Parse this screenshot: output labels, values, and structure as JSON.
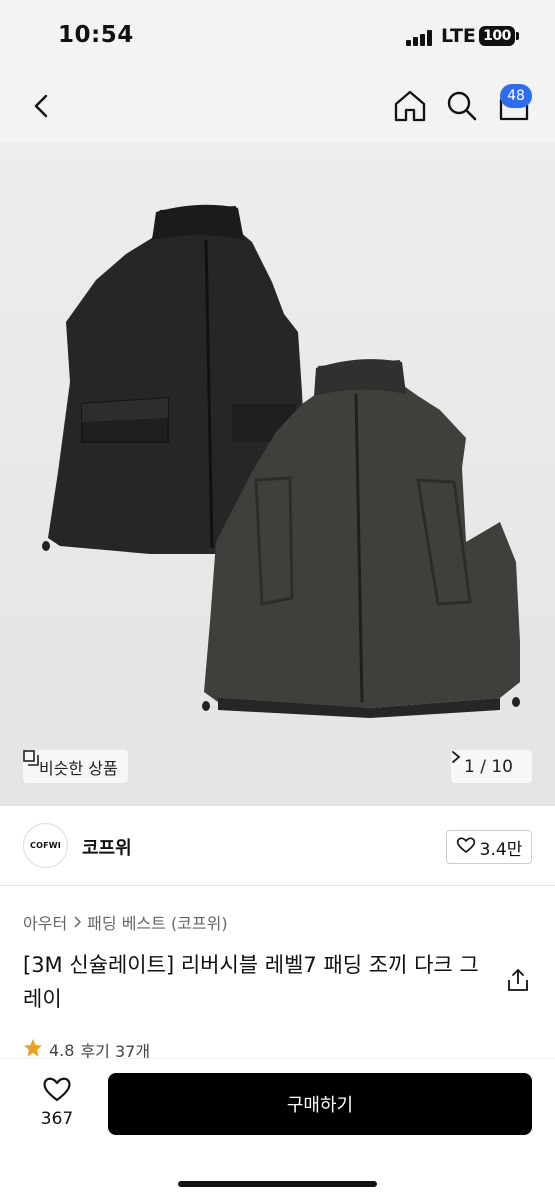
{
  "status_bar": {
    "time": "10:54",
    "network": "LTE",
    "battery": "100"
  },
  "nav": {
    "back_icon": "chevron-left-icon",
    "home_icon": "home-icon",
    "search_icon": "search-icon",
    "cart_icon": "cart-icon",
    "cart_count": "48",
    "badge_color": "#2f6cf0"
  },
  "gallery": {
    "similar_label": "비슷한 상품",
    "pager": "1 / 10"
  },
  "brand": {
    "logo_text": "COFWI",
    "name": "코프위",
    "likes": "3.4만"
  },
  "product": {
    "breadcrumb": [
      "아우터",
      "패딩 베스트 (코프위)"
    ],
    "title": "[3M 신슐레이트] 리버시블 레벨7 패딩 조끼 다크 그레이",
    "rating": "4.8",
    "reviews": "후기 37개"
  },
  "bottom_bar": {
    "wish_count": "367",
    "buy_label": "구매하기"
  }
}
